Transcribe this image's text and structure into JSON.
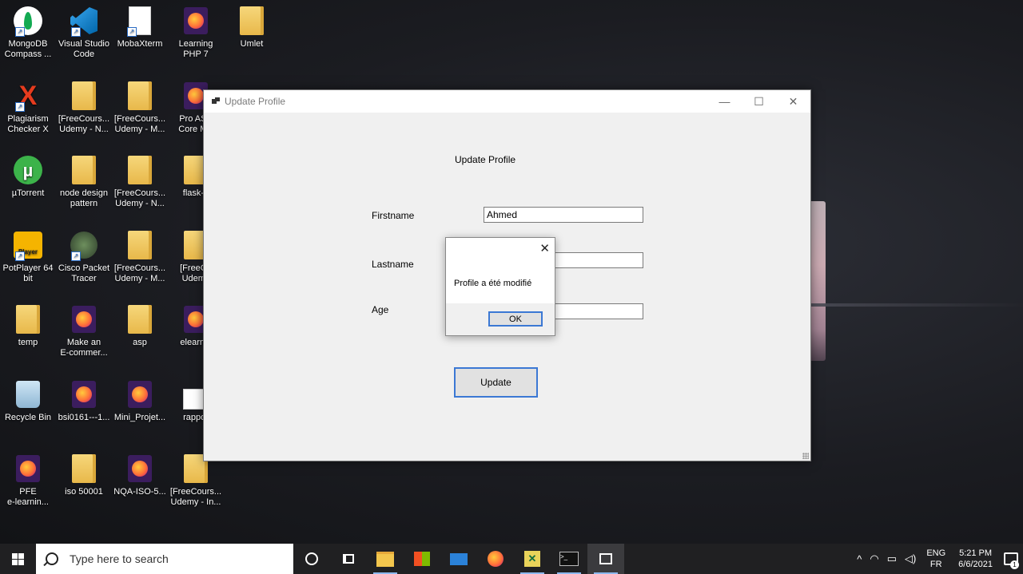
{
  "desktop": {
    "icons": [
      {
        "label": "MongoDB\nCompass ...",
        "icon": "mongodb-compass-icon"
      },
      {
        "label": "Visual Studio\nCode",
        "icon": "vscode-icon"
      },
      {
        "label": "MobaXterm",
        "icon": "file-icon"
      },
      {
        "label": "Learning\nPHP 7",
        "icon": "firefox-icon"
      },
      {
        "label": "Umlet",
        "icon": "folder-icon"
      },
      {
        "label": "Plagiarism\nChecker X",
        "icon": "plagiarism-checker-icon"
      },
      {
        "label": "[FreeCours...\nUdemy - N...",
        "icon": "folder-icon"
      },
      {
        "label": "[FreeCours...\nUdemy - M...",
        "icon": "folder-icon"
      },
      {
        "label": "Pro ASP\nCore MV",
        "icon": "firefox-icon"
      },
      {
        "label": "µTorrent",
        "icon": "utorrent-icon"
      },
      {
        "label": "node design\npattern",
        "icon": "folder-icon"
      },
      {
        "label": "[FreeCours...\nUdemy - N...",
        "icon": "folder-icon"
      },
      {
        "label": "flask-b",
        "icon": "folder-icon"
      },
      {
        "label": "PotPlayer 64\nbit",
        "icon": "potplayer-icon"
      },
      {
        "label": "Cisco Packet\nTracer",
        "icon": "cisco-packet-tracer-icon"
      },
      {
        "label": "[FreeCours...\nUdemy - M...",
        "icon": "folder-icon"
      },
      {
        "label": "[FreeCo\nUdemy",
        "icon": "folder-icon"
      },
      {
        "label": "temp",
        "icon": "folder-icon"
      },
      {
        "label": "Make an\nE-commer...",
        "icon": "firefox-icon"
      },
      {
        "label": "asp",
        "icon": "folder-icon"
      },
      {
        "label": "elearnin",
        "icon": "firefox-icon"
      },
      {
        "label": "Recycle Bin",
        "icon": "recycle-bin-icon"
      },
      {
        "label": "bsi0161---1...",
        "icon": "firefox-icon"
      },
      {
        "label": "Mini_Projet...",
        "icon": "firefox-icon"
      },
      {
        "label": "rappor",
        "icon": "document-icon"
      },
      {
        "label": "PFE\ne-learnin...",
        "icon": "firefox-icon"
      },
      {
        "label": "iso 50001",
        "icon": "folder-icon"
      },
      {
        "label": "NQA-ISO-5...",
        "icon": "firefox-icon"
      },
      {
        "label": "[FreeCours...\nUdemy - In...",
        "icon": "folder-icon"
      }
    ]
  },
  "window": {
    "title": "Update Profile",
    "controls": {
      "minimize": "—",
      "maximize": "☐",
      "close": "✕"
    },
    "form_title": "Update Profile",
    "fields": {
      "firstname": {
        "label": "Firstname",
        "value": "Ahmed"
      },
      "lastname": {
        "label": "Lastname",
        "value": ""
      },
      "age": {
        "label": "Age",
        "value": ""
      }
    },
    "update_button": "Update"
  },
  "message_box": {
    "close": "✕",
    "text": "Profile a été modifié",
    "ok": "OK"
  },
  "taskbar": {
    "search_placeholder": "Type here to search",
    "apps": [
      "cortana-icon",
      "task-view-icon",
      "file-explorer-icon",
      "store-icon",
      "mail-icon",
      "firefox-icon",
      "xd-icon",
      "terminal-icon",
      "app-window-icon"
    ],
    "tray": {
      "chevron": "^",
      "lang_top": "ENG",
      "lang_bottom": "FR",
      "time": "5:21 PM",
      "date": "6/6/2021",
      "notifications": "1"
    }
  }
}
